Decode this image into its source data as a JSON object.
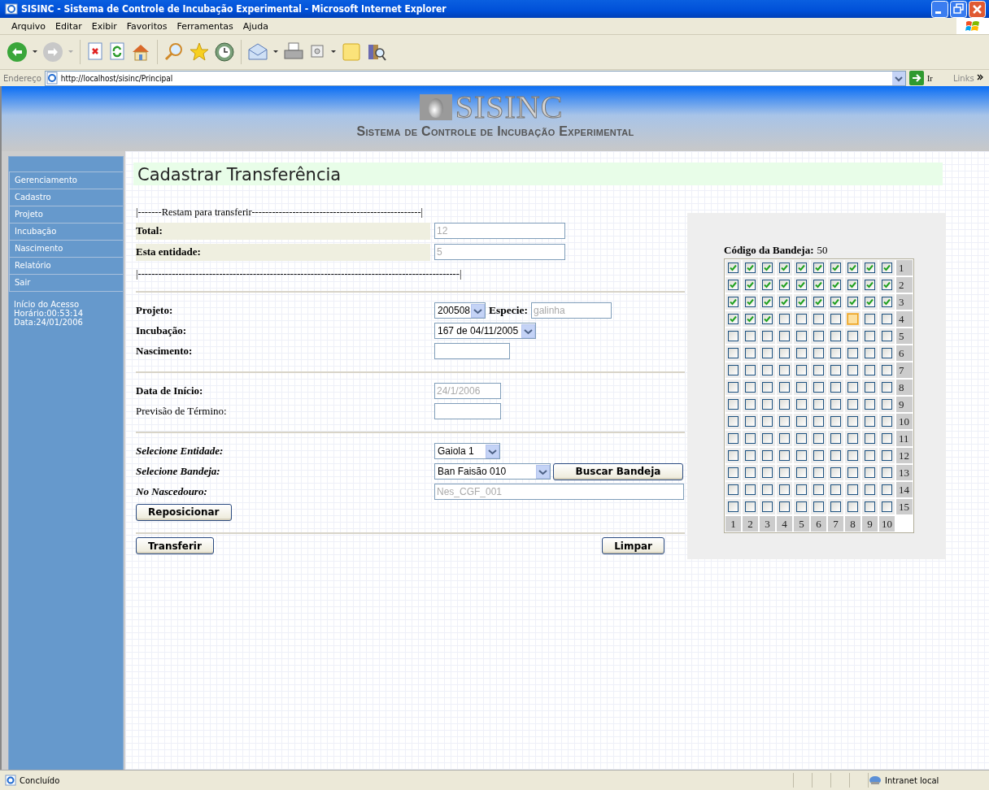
{
  "window": {
    "title": "SISINC - Sistema de Controle de Incubação Experimental - Microsoft Internet Explorer"
  },
  "menu": [
    "Arquivo",
    "Editar",
    "Exibir",
    "Favoritos",
    "Ferramentas",
    "Ajuda"
  ],
  "address": {
    "label": "Endereço",
    "value": "http://localhost/sisinc/Principal",
    "go": "Ir",
    "links": "Links"
  },
  "header": {
    "logo": "SISINC",
    "subtitle": "Sistema de Controle de Incubação Experimental"
  },
  "sidebar": {
    "items": [
      {
        "label": "Gerenciamento"
      },
      {
        "label": "Cadastro"
      },
      {
        "label": "Projeto"
      },
      {
        "label": "Incubação"
      },
      {
        "label": "Nascimento"
      },
      {
        "label": "Relatório"
      },
      {
        "label": "Sair"
      }
    ],
    "session": [
      "Início do Acesso",
      "Horário:00:53:14",
      "Data:24/01/2006"
    ]
  },
  "page": {
    "title": "Cadastrar Transferência"
  },
  "remaining": {
    "top_rule": "|-------Restam para transferir--------------------------------------------------|",
    "fields": [
      {
        "label": "Total:",
        "value": "12"
      },
      {
        "label": "Esta entidade:",
        "value": "5"
      }
    ],
    "bottom_rule": "|-----------------------------------------------------------------------------------------------|"
  },
  "form": {
    "sections": [
      {
        "rows": [
          {
            "kind": "select-field",
            "label": "Projeto:",
            "label_bold": true,
            "label_italic": false,
            "value": "200508",
            "extra_label": "Especie:",
            "extra_value": "galinha",
            "disabled": true
          },
          {
            "kind": "select",
            "label": "Incubação:",
            "label_bold": true,
            "label_italic": false,
            "value": "167 de 04/11/2005"
          },
          {
            "kind": "input",
            "label": "Nascimento:",
            "label_bold": true,
            "label_italic": false
          }
        ]
      },
      {
        "rows": [
          {
            "kind": "input",
            "label": "Data de Início:",
            "label_bold": true,
            "label_italic": false,
            "value": "24/1/2006",
            "disabled": true
          },
          {
            "kind": "input",
            "label": "Previsão de Término:",
            "label_bold": false,
            "label_italic": false
          }
        ]
      },
      {
        "rows": [
          {
            "kind": "select",
            "label": "Selecione Entidade:",
            "label_bold": true,
            "label_italic": true,
            "value": "Gaiola 1"
          },
          {
            "kind": "select-button",
            "label": "Selecione Bandeja:",
            "label_bold": true,
            "label_italic": true,
            "value": "Ban Faisão 010",
            "button": "Buscar Bandeja"
          },
          {
            "kind": "wide-input",
            "label": "No Nascedouro:",
            "label_bold": true,
            "label_italic": true,
            "value": "Nes_CGF_001",
            "disabled": true
          },
          {
            "kind": "button",
            "button": "Reposicionar"
          }
        ]
      }
    ]
  },
  "actions": [
    {
      "label": "Transferir"
    },
    {
      "label": "Limpar"
    }
  ],
  "tray": {
    "label": "Código da Bandeja:",
    "code": "50",
    "rows": [
      {
        "label": "1",
        "cells": [
          {
            "checked": true,
            "focused": false
          },
          {
            "checked": true,
            "focused": false
          },
          {
            "checked": true,
            "focused": false
          },
          {
            "checked": true,
            "focused": false
          },
          {
            "checked": true,
            "focused": false
          },
          {
            "checked": true,
            "focused": false
          },
          {
            "checked": true,
            "focused": false
          },
          {
            "checked": true,
            "focused": false
          },
          {
            "checked": true,
            "focused": false
          },
          {
            "checked": true,
            "focused": false
          }
        ]
      },
      {
        "label": "2",
        "cells": [
          {
            "checked": true,
            "focused": false
          },
          {
            "checked": true,
            "focused": false
          },
          {
            "checked": true,
            "focused": false
          },
          {
            "checked": true,
            "focused": false
          },
          {
            "checked": true,
            "focused": false
          },
          {
            "checked": true,
            "focused": false
          },
          {
            "checked": true,
            "focused": false
          },
          {
            "checked": true,
            "focused": false
          },
          {
            "checked": true,
            "focused": false
          },
          {
            "checked": true,
            "focused": false
          }
        ]
      },
      {
        "label": "3",
        "cells": [
          {
            "checked": true,
            "focused": false
          },
          {
            "checked": true,
            "focused": false
          },
          {
            "checked": true,
            "focused": false
          },
          {
            "checked": true,
            "focused": false
          },
          {
            "checked": true,
            "focused": false
          },
          {
            "checked": true,
            "focused": false
          },
          {
            "checked": true,
            "focused": false
          },
          {
            "checked": true,
            "focused": false
          },
          {
            "checked": true,
            "focused": false
          },
          {
            "checked": true,
            "focused": false
          }
        ]
      },
      {
        "label": "4",
        "cells": [
          {
            "checked": true,
            "focused": false
          },
          {
            "checked": true,
            "focused": false
          },
          {
            "checked": true,
            "focused": false
          },
          {
            "checked": false,
            "focused": false
          },
          {
            "checked": false,
            "focused": false
          },
          {
            "checked": false,
            "focused": false
          },
          {
            "checked": false,
            "focused": false
          },
          {
            "checked": false,
            "focused": true
          },
          {
            "checked": false,
            "focused": false
          },
          {
            "checked": false,
            "focused": false
          }
        ]
      },
      {
        "label": "5",
        "cells": [
          {
            "checked": false,
            "focused": false
          },
          {
            "checked": false,
            "focused": false
          },
          {
            "checked": false,
            "focused": false
          },
          {
            "checked": false,
            "focused": false
          },
          {
            "checked": false,
            "focused": false
          },
          {
            "checked": false,
            "focused": false
          },
          {
            "checked": false,
            "focused": false
          },
          {
            "checked": false,
            "focused": false
          },
          {
            "checked": false,
            "focused": false
          },
          {
            "checked": false,
            "focused": false
          }
        ]
      },
      {
        "label": "6",
        "cells": [
          {
            "checked": false,
            "focused": false
          },
          {
            "checked": false,
            "focused": false
          },
          {
            "checked": false,
            "focused": false
          },
          {
            "checked": false,
            "focused": false
          },
          {
            "checked": false,
            "focused": false
          },
          {
            "checked": false,
            "focused": false
          },
          {
            "checked": false,
            "focused": false
          },
          {
            "checked": false,
            "focused": false
          },
          {
            "checked": false,
            "focused": false
          },
          {
            "checked": false,
            "focused": false
          }
        ]
      },
      {
        "label": "7",
        "cells": [
          {
            "checked": false,
            "focused": false
          },
          {
            "checked": false,
            "focused": false
          },
          {
            "checked": false,
            "focused": false
          },
          {
            "checked": false,
            "focused": false
          },
          {
            "checked": false,
            "focused": false
          },
          {
            "checked": false,
            "focused": false
          },
          {
            "checked": false,
            "focused": false
          },
          {
            "checked": false,
            "focused": false
          },
          {
            "checked": false,
            "focused": false
          },
          {
            "checked": false,
            "focused": false
          }
        ]
      },
      {
        "label": "8",
        "cells": [
          {
            "checked": false,
            "focused": false
          },
          {
            "checked": false,
            "focused": false
          },
          {
            "checked": false,
            "focused": false
          },
          {
            "checked": false,
            "focused": false
          },
          {
            "checked": false,
            "focused": false
          },
          {
            "checked": false,
            "focused": false
          },
          {
            "checked": false,
            "focused": false
          },
          {
            "checked": false,
            "focused": false
          },
          {
            "checked": false,
            "focused": false
          },
          {
            "checked": false,
            "focused": false
          }
        ]
      },
      {
        "label": "9",
        "cells": [
          {
            "checked": false,
            "focused": false
          },
          {
            "checked": false,
            "focused": false
          },
          {
            "checked": false,
            "focused": false
          },
          {
            "checked": false,
            "focused": false
          },
          {
            "checked": false,
            "focused": false
          },
          {
            "checked": false,
            "focused": false
          },
          {
            "checked": false,
            "focused": false
          },
          {
            "checked": false,
            "focused": false
          },
          {
            "checked": false,
            "focused": false
          },
          {
            "checked": false,
            "focused": false
          }
        ]
      },
      {
        "label": "10",
        "cells": [
          {
            "checked": false,
            "focused": false
          },
          {
            "checked": false,
            "focused": false
          },
          {
            "checked": false,
            "focused": false
          },
          {
            "checked": false,
            "focused": false
          },
          {
            "checked": false,
            "focused": false
          },
          {
            "checked": false,
            "focused": false
          },
          {
            "checked": false,
            "focused": false
          },
          {
            "checked": false,
            "focused": false
          },
          {
            "checked": false,
            "focused": false
          },
          {
            "checked": false,
            "focused": false
          }
        ]
      },
      {
        "label": "11",
        "cells": [
          {
            "checked": false,
            "focused": false
          },
          {
            "checked": false,
            "focused": false
          },
          {
            "checked": false,
            "focused": false
          },
          {
            "checked": false,
            "focused": false
          },
          {
            "checked": false,
            "focused": false
          },
          {
            "checked": false,
            "focused": false
          },
          {
            "checked": false,
            "focused": false
          },
          {
            "checked": false,
            "focused": false
          },
          {
            "checked": false,
            "focused": false
          },
          {
            "checked": false,
            "focused": false
          }
        ]
      },
      {
        "label": "12",
        "cells": [
          {
            "checked": false,
            "focused": false
          },
          {
            "checked": false,
            "focused": false
          },
          {
            "checked": false,
            "focused": false
          },
          {
            "checked": false,
            "focused": false
          },
          {
            "checked": false,
            "focused": false
          },
          {
            "checked": false,
            "focused": false
          },
          {
            "checked": false,
            "focused": false
          },
          {
            "checked": false,
            "focused": false
          },
          {
            "checked": false,
            "focused": false
          },
          {
            "checked": false,
            "focused": false
          }
        ]
      },
      {
        "label": "13",
        "cells": [
          {
            "checked": false,
            "focused": false
          },
          {
            "checked": false,
            "focused": false
          },
          {
            "checked": false,
            "focused": false
          },
          {
            "checked": false,
            "focused": false
          },
          {
            "checked": false,
            "focused": false
          },
          {
            "checked": false,
            "focused": false
          },
          {
            "checked": false,
            "focused": false
          },
          {
            "checked": false,
            "focused": false
          },
          {
            "checked": false,
            "focused": false
          },
          {
            "checked": false,
            "focused": false
          }
        ]
      },
      {
        "label": "14",
        "cells": [
          {
            "checked": false,
            "focused": false
          },
          {
            "checked": false,
            "focused": false
          },
          {
            "checked": false,
            "focused": false
          },
          {
            "checked": false,
            "focused": false
          },
          {
            "checked": false,
            "focused": false
          },
          {
            "checked": false,
            "focused": false
          },
          {
            "checked": false,
            "focused": false
          },
          {
            "checked": false,
            "focused": false
          },
          {
            "checked": false,
            "focused": false
          },
          {
            "checked": false,
            "focused": false
          }
        ]
      },
      {
        "label": "15",
        "cells": [
          {
            "checked": false,
            "focused": false
          },
          {
            "checked": false,
            "focused": false
          },
          {
            "checked": false,
            "focused": false
          },
          {
            "checked": false,
            "focused": false
          },
          {
            "checked": false,
            "focused": false
          },
          {
            "checked": false,
            "focused": false
          },
          {
            "checked": false,
            "focused": false
          },
          {
            "checked": false,
            "focused": false
          },
          {
            "checked": false,
            "focused": false
          },
          {
            "checked": false,
            "focused": false
          }
        ]
      }
    ],
    "column_labels": [
      "1",
      "2",
      "3",
      "4",
      "5",
      "6",
      "7",
      "8",
      "9",
      "10"
    ]
  },
  "status_bar": {
    "text": "Concluído",
    "zone": "Intranet local"
  }
}
